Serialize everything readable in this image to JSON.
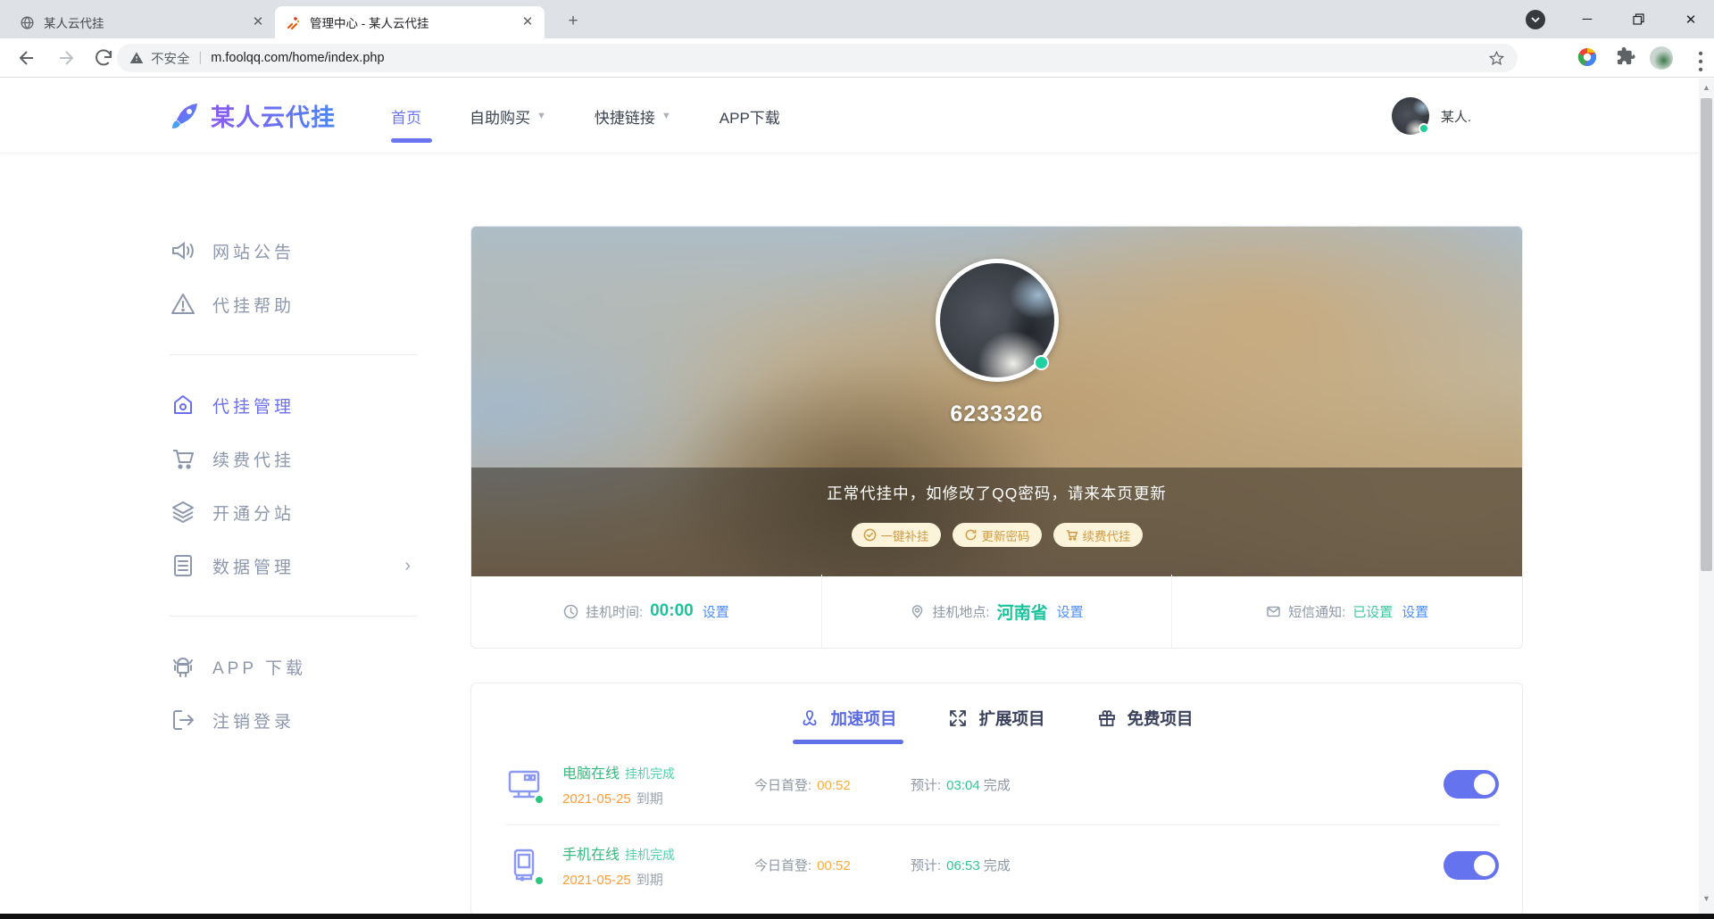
{
  "browser": {
    "tabs": [
      {
        "title": "某人云代挂",
        "icon": "globe-icon",
        "active": false
      },
      {
        "title": "管理中心 - 某人云代挂",
        "icon": "rocket-favicon",
        "active": true
      }
    ],
    "new_tab_label": "+",
    "security_label": "不安全",
    "url": "m.foolqq.com/home/index.php"
  },
  "header": {
    "brand": "某人云代挂",
    "nav": [
      {
        "label": "首页",
        "active": true
      },
      {
        "label": "自助购买",
        "dropdown": true
      },
      {
        "label": "快捷链接",
        "dropdown": true
      },
      {
        "label": "APP下载",
        "dropdown": false
      }
    ],
    "user_name": "某人."
  },
  "sidebar": {
    "groups": [
      {
        "items": [
          {
            "icon": "speaker-icon",
            "label": "网站公告"
          },
          {
            "icon": "alert-icon",
            "label": "代挂帮助"
          }
        ]
      },
      {
        "items": [
          {
            "icon": "home-icon",
            "label": "代挂管理",
            "active": true
          },
          {
            "icon": "cart-icon",
            "label": "续费代挂"
          },
          {
            "icon": "layers-icon",
            "label": "开通分站"
          },
          {
            "icon": "document-icon",
            "label": "数据管理",
            "expandable": true,
            "chevron": "›"
          }
        ]
      },
      {
        "items": [
          {
            "icon": "android-icon",
            "label": "APP 下载"
          },
          {
            "icon": "logout-icon",
            "label": "注销登录"
          }
        ]
      }
    ]
  },
  "profile": {
    "qq_number": "6233326",
    "online_status": "online",
    "notice": "正常代挂中，如修改了QQ密码，请来本页更新",
    "actions": [
      {
        "icon": "check-circle-icon",
        "label": "一键补挂"
      },
      {
        "icon": "refresh-icon",
        "label": "更新密码"
      },
      {
        "icon": "cart-icon",
        "label": "续费代挂"
      }
    ],
    "stats": [
      {
        "icon": "clock-icon",
        "label": "挂机时间:",
        "value": "00:00",
        "link": "设置"
      },
      {
        "icon": "location-icon",
        "label": "挂机地点:",
        "value": "河南省",
        "link": "设置"
      },
      {
        "icon": "sms-icon",
        "label": "短信通知:",
        "value": "已设置",
        "link": "设置"
      }
    ]
  },
  "projects": {
    "tabs": [
      {
        "icon": "accel-icon",
        "label": "加速项目",
        "active": true
      },
      {
        "icon": "expand-icon",
        "label": "扩展项目",
        "active": false
      },
      {
        "icon": "gift-icon",
        "label": "免费项目",
        "active": false
      }
    ],
    "rows": [
      {
        "icon": "desktop-icon",
        "title": "电脑在线",
        "status": "挂机完成",
        "date": "2021-05-25",
        "date_suffix": "到期",
        "login_label": "今日首登:",
        "login_value": "00:52",
        "eta_label": "预计:",
        "eta_value": "03:04",
        "eta_suffix": "完成",
        "toggle_on": true
      },
      {
        "icon": "phone-icon",
        "title": "手机在线",
        "status": "挂机完成",
        "date": "2021-05-25",
        "date_suffix": "到期",
        "login_label": "今日首登:",
        "login_value": "00:52",
        "eta_label": "预计:",
        "eta_value": "06:53",
        "eta_suffix": "完成",
        "toggle_on": true
      }
    ]
  },
  "colors": {
    "accent_purple": "#6a75f2",
    "tab_active": "#5a6ae0",
    "green_value": "#1bc49c",
    "green_title": "#35b97f",
    "orange": "#ff9c35",
    "link_blue": "#4f8ef7",
    "gold_text": "#cf9d49",
    "gold_bg": "#fbf3da",
    "toggle_on": "#6673ee"
  }
}
